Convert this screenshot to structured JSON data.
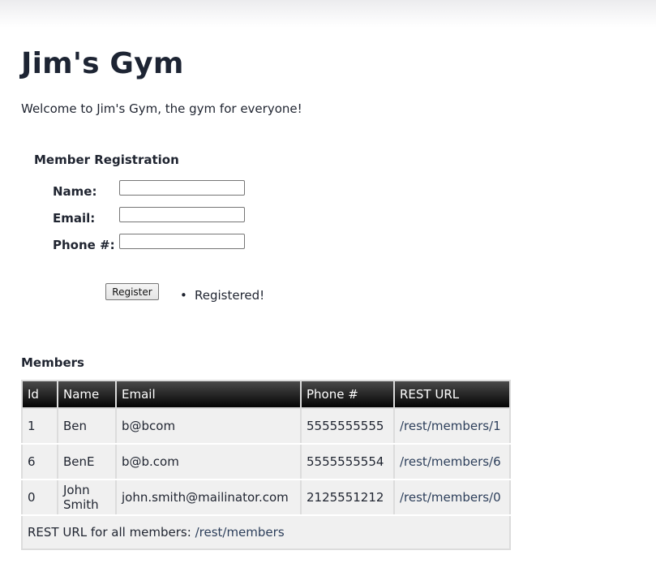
{
  "header": {
    "title": "Jim's Gym",
    "welcome": "Welcome to Jim's Gym, the gym for everyone!"
  },
  "registration": {
    "title": "Member Registration",
    "name_label": "Name:",
    "name_value": "",
    "email_label": "Email:",
    "email_value": "",
    "phone_label": "Phone #:",
    "phone_value": "",
    "register_label": "Register",
    "messages": [
      "Registered!"
    ]
  },
  "members": {
    "title": "Members",
    "columns": [
      "Id",
      "Name",
      "Email",
      "Phone #",
      "REST URL"
    ],
    "rows": [
      {
        "id": "1",
        "name": "Ben",
        "email": "b@bcom",
        "phone": "5555555555",
        "rest_url": "/rest/members/1"
      },
      {
        "id": "6",
        "name": "BenE",
        "email": "b@b.com",
        "phone": "5555555554",
        "rest_url": "/rest/members/6"
      },
      {
        "id": "0",
        "name": "John Smith",
        "email": "john.smith@mailinator.com",
        "phone": "2125551212",
        "rest_url": "/rest/members/0"
      }
    ],
    "footer_text": "REST URL for all members: ",
    "footer_link": "/rest/members"
  }
}
